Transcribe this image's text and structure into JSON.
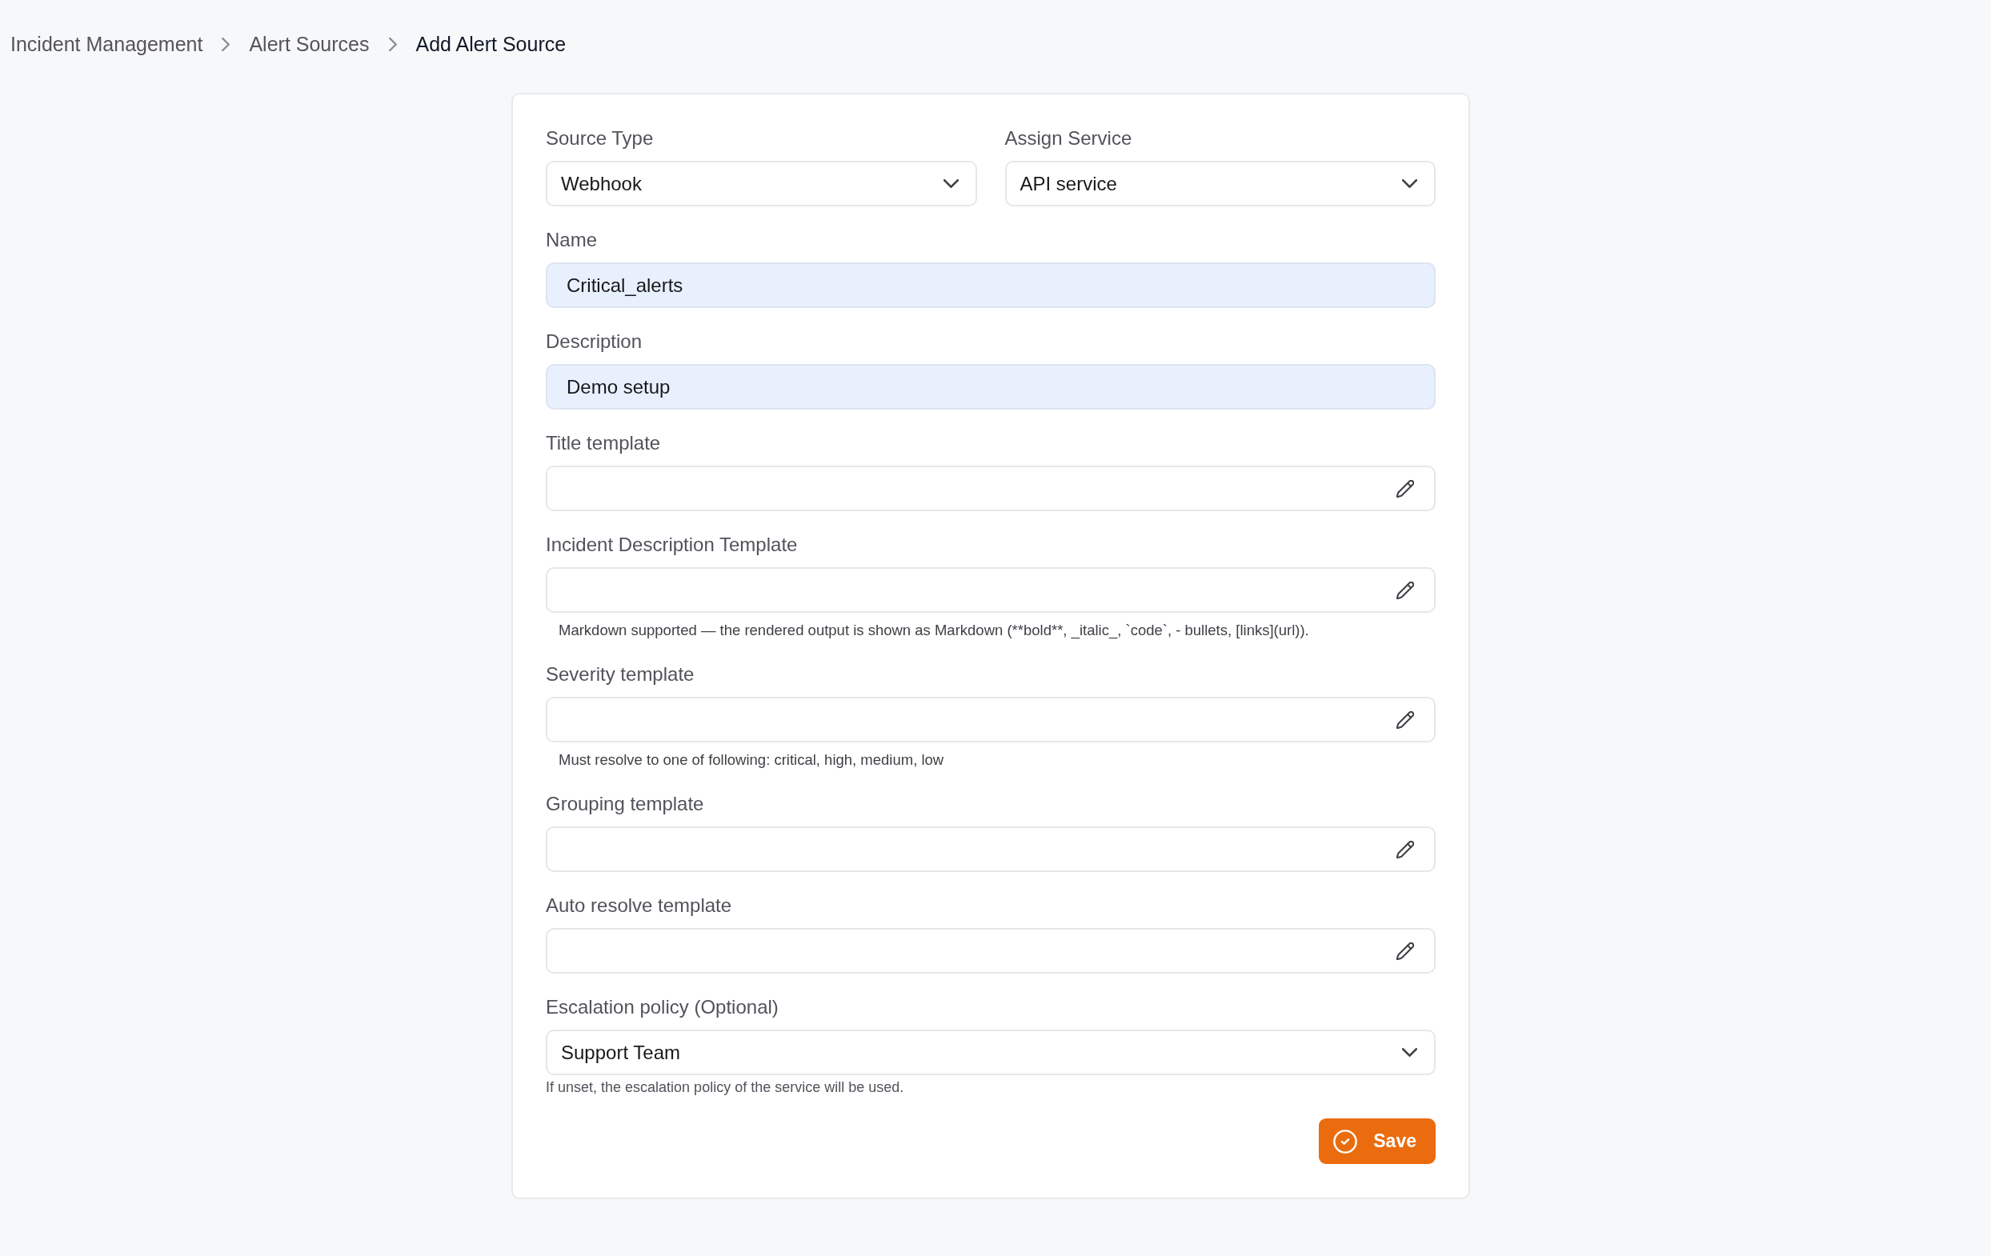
{
  "breadcrumb": [
    {
      "label": "Incident Management",
      "current": false
    },
    {
      "label": "Alert Sources",
      "current": false
    },
    {
      "label": "Add Alert Source",
      "current": true
    }
  ],
  "form": {
    "rows": [
      {
        "fields": [
          {
            "kind": "select",
            "label": "Source Type",
            "value": "Webhook"
          },
          {
            "kind": "select",
            "label": "Assign Service",
            "value": "API service"
          }
        ]
      },
      {
        "fields": [
          {
            "kind": "text",
            "label": "Name",
            "value": "Critical_alerts",
            "autofilled": true
          }
        ]
      },
      {
        "fields": [
          {
            "kind": "text",
            "label": "Description",
            "value": "Demo setup",
            "autofilled": true
          }
        ]
      },
      {
        "fields": [
          {
            "kind": "template",
            "label": "Title template"
          }
        ]
      },
      {
        "fields": [
          {
            "kind": "template",
            "label": "Incident Description Template",
            "hint": "Markdown supported — the rendered output is shown as Markdown (**bold**, _italic_, `code`, - bullets, [links](url))."
          }
        ]
      },
      {
        "fields": [
          {
            "kind": "template",
            "label": "Severity template",
            "hint": "Must resolve to one of following: critical, high, medium, low"
          }
        ]
      },
      {
        "fields": [
          {
            "kind": "template",
            "label": "Grouping template"
          }
        ]
      },
      {
        "fields": [
          {
            "kind": "template",
            "label": "Auto resolve template"
          }
        ]
      },
      {
        "fields": [
          {
            "kind": "select",
            "label": "Escalation policy (Optional)",
            "value": "Support Team",
            "hint": "If unset, the escalation policy of the service will be used."
          }
        ]
      }
    ],
    "save_button": {
      "label": "Save"
    }
  }
}
